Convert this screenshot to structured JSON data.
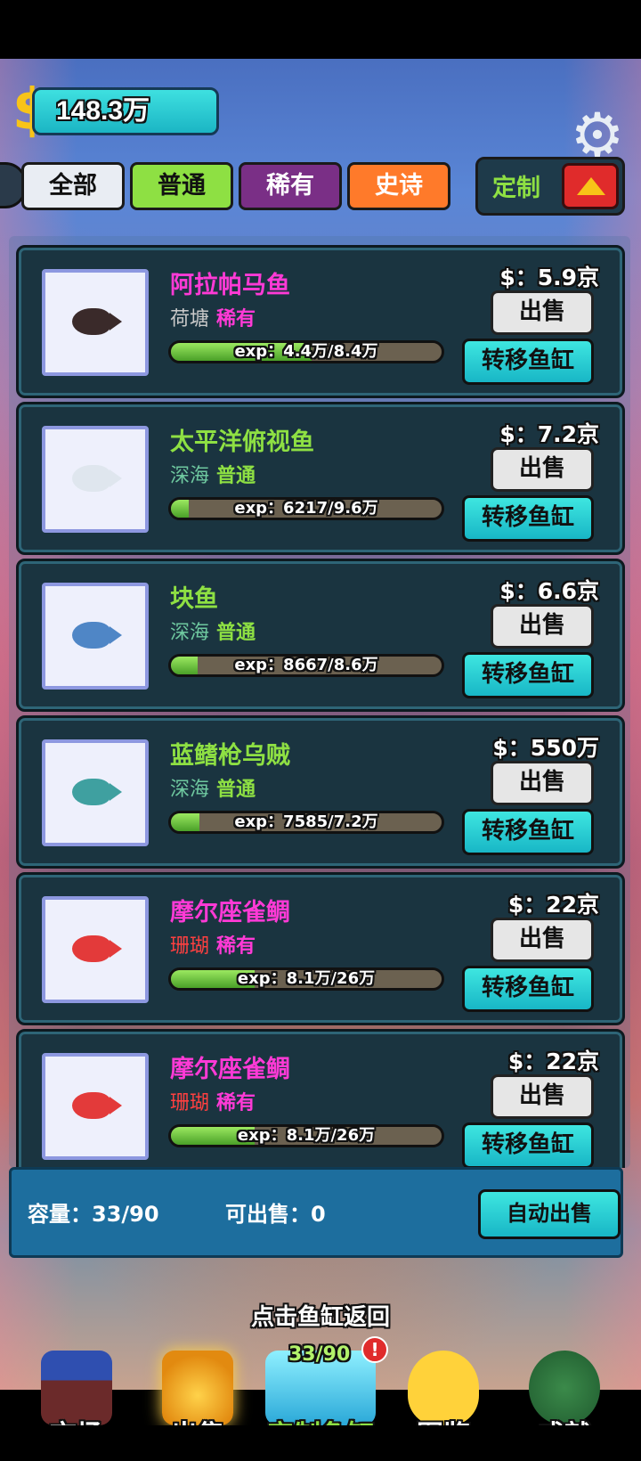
{
  "hud": {
    "money": "148.3万",
    "coin_symbol": "$"
  },
  "filters": {
    "all": "全部",
    "common": "普通",
    "rare": "稀有",
    "epic": "史诗",
    "custom": "定制"
  },
  "fish": [
    {
      "name": "阿拉帕马鱼",
      "habitat": "荷塘",
      "rarity": "稀有",
      "exp": "exp：4.4万/8.4万",
      "exp_progress": 0.52,
      "price": "$：5.9京",
      "sell": "出售",
      "move": "转移鱼缸",
      "name_color": "#ff3ad6",
      "rarity_color": "#ff3ad6",
      "habitat_color": "#c9c9c9",
      "sprite_color": "#3a2a2a"
    },
    {
      "name": "太平洋俯视鱼",
      "habitat": "深海",
      "rarity": "普通",
      "exp": "exp：6217/9.6万",
      "exp_progress": 0.065,
      "price": "$：7.2京",
      "sell": "出售",
      "move": "转移鱼缸",
      "name_color": "#8ee043",
      "rarity_color": "#8ee043",
      "habitat_color": "#6fc9a0",
      "sprite_color": "#dfe6ee"
    },
    {
      "name": "块鱼",
      "habitat": "深海",
      "rarity": "普通",
      "exp": "exp：8667/8.6万",
      "exp_progress": 0.1,
      "price": "$：6.6京",
      "sell": "出售",
      "move": "转移鱼缸",
      "name_color": "#8ee043",
      "rarity_color": "#8ee043",
      "habitat_color": "#6fc9a0",
      "sprite_color": "#4f86c6"
    },
    {
      "name": "蓝鳍枪乌贼",
      "habitat": "深海",
      "rarity": "普通",
      "exp": "exp：7585/7.2万",
      "exp_progress": 0.105,
      "price": "$：550万",
      "sell": "出售",
      "move": "转移鱼缸",
      "name_color": "#8ee043",
      "rarity_color": "#8ee043",
      "habitat_color": "#6fc9a0",
      "sprite_color": "#3fa0a0"
    },
    {
      "name": "摩尔座雀鲷",
      "habitat": "珊瑚",
      "rarity": "稀有",
      "exp": "exp：8.1万/26万",
      "exp_progress": 0.31,
      "price": "$：22京",
      "sell": "出售",
      "move": "转移鱼缸",
      "name_color": "#ff3ad6",
      "rarity_color": "#ff3ad6",
      "habitat_color": "#ff4040",
      "sprite_color": "#e33a3a"
    },
    {
      "name": "摩尔座雀鲷",
      "habitat": "珊瑚",
      "rarity": "稀有",
      "exp": "exp：8.1万/26万",
      "exp_progress": 0.31,
      "price": "$：22京",
      "sell": "出售",
      "move": "转移鱼缸",
      "name_color": "#ff3ad6",
      "rarity_color": "#ff3ad6",
      "habitat_color": "#ff4040",
      "sprite_color": "#e33a3a"
    }
  ],
  "info": {
    "capacity": "容量：33/90",
    "sellable": "可出售：0",
    "auto_sell": "自动出售"
  },
  "hint": "点击鱼缸返回",
  "nav": {
    "market": "市场",
    "sell": "出售",
    "custom_tank": "定制鱼缸",
    "custom_count": "33/90",
    "alert": "!",
    "atlas": "图鉴",
    "achievements": "成就"
  }
}
